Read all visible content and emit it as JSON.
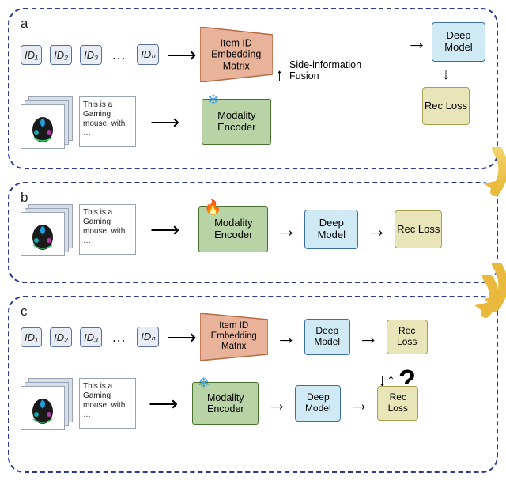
{
  "panels": {
    "a": {
      "label": "a"
    },
    "b": {
      "label": "b"
    },
    "c": {
      "label": "c"
    }
  },
  "ids": {
    "id1": "ID₁",
    "id2": "ID₂",
    "id3": "ID₃",
    "ellipsis": "…",
    "idn": "IDₙ"
  },
  "text_card": "This is a Gaming mouse, with …",
  "blocks": {
    "embedding": "Item ID Embedding Matrix",
    "encoder": "Modality Encoder",
    "deep_model": "Deep Model",
    "rec_loss": "Rec Loss"
  },
  "labels": {
    "side_info": "Side-information Fusion",
    "question": "?"
  },
  "icons": {
    "frozen": "❄",
    "trainable": "🔥"
  }
}
